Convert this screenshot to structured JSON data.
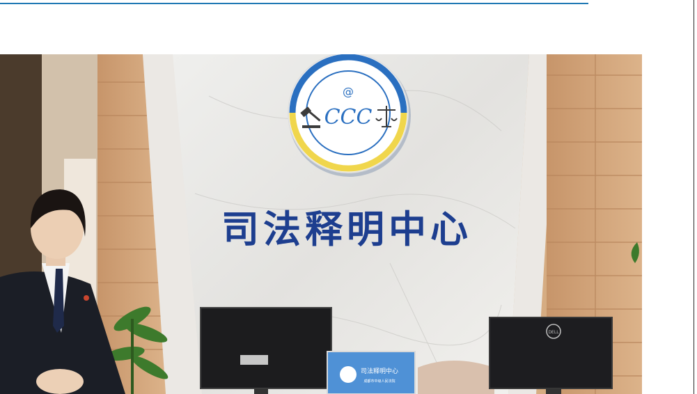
{
  "photo": {
    "sign_text": "司法释明中心",
    "logo_symbol": "@",
    "logo_letters": "CCC",
    "screen_title": "司法释明中心",
    "screen_sub": "成都市中级人民法院",
    "monitor_brand": "DELL",
    "icons": [
      "gavel-icon",
      "scales-icon",
      "at-icon"
    ],
    "colors": {
      "accent_blue": "#1f78b4",
      "logo_blue": "#2a6fc0",
      "logo_yellow": "#f0d64c",
      "sign_blue": "#1d3e8f"
    }
  }
}
